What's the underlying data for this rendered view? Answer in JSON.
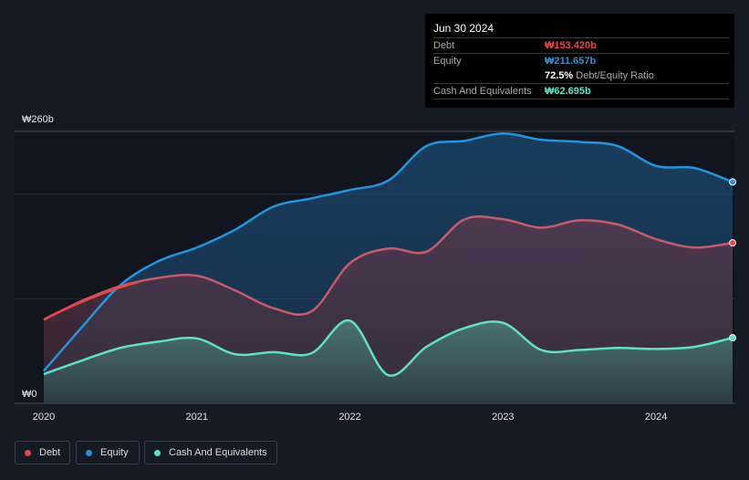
{
  "tooltip": {
    "date": "Jun 30 2024",
    "debt_label": "Debt",
    "debt_value": "₩153.420b",
    "equity_label": "Equity",
    "equity_value": "₩211.657b",
    "ratio_value": "72.5%",
    "ratio_label": "Debt/Equity Ratio",
    "cash_label": "Cash And Equivalents",
    "cash_value": "₩62.695b"
  },
  "legend": [
    {
      "label": "Debt",
      "color": "#e8464a"
    },
    {
      "label": "Equity",
      "color": "#2394df"
    },
    {
      "label": "Cash And Equivalents",
      "color": "#5fe0c8"
    }
  ],
  "chart_data": {
    "type": "area",
    "title": "",
    "y_tick_labels": [
      "₩260b",
      "₩0"
    ],
    "ylim": [
      0,
      260
    ],
    "x_tick_labels": [
      "2020",
      "2021",
      "2022",
      "2023",
      "2024"
    ],
    "xlim": [
      2020,
      2024.5
    ],
    "x": [
      2020,
      2020.25,
      2020.5,
      2020.75,
      2021,
      2021.25,
      2021.5,
      2021.75,
      2022,
      2022.25,
      2022.5,
      2022.75,
      2023,
      2023.25,
      2023.5,
      2023.75,
      2024,
      2024.25,
      2024.5
    ],
    "series": [
      {
        "name": "Equity",
        "color": "#2394df",
        "values": [
          31,
          73,
          113,
          136,
          149,
          166,
          188,
          196,
          204,
          213,
          246,
          251,
          258,
          252,
          250,
          246,
          227,
          225,
          211.657
        ]
      },
      {
        "name": "Debt",
        "color": "#e8464a",
        "values": [
          80,
          98,
          112,
          120,
          122,
          108,
          91,
          88,
          134,
          148,
          145,
          176,
          176,
          168,
          175,
          171,
          157,
          149,
          153.42
        ]
      },
      {
        "name": "Cash And Equivalents",
        "color": "#5fe0c8",
        "values": [
          28,
          41,
          53,
          59,
          62,
          47,
          49,
          48,
          79,
          27,
          54,
          72,
          77,
          51,
          51,
          53,
          52,
          54,
          62.695
        ]
      }
    ]
  }
}
